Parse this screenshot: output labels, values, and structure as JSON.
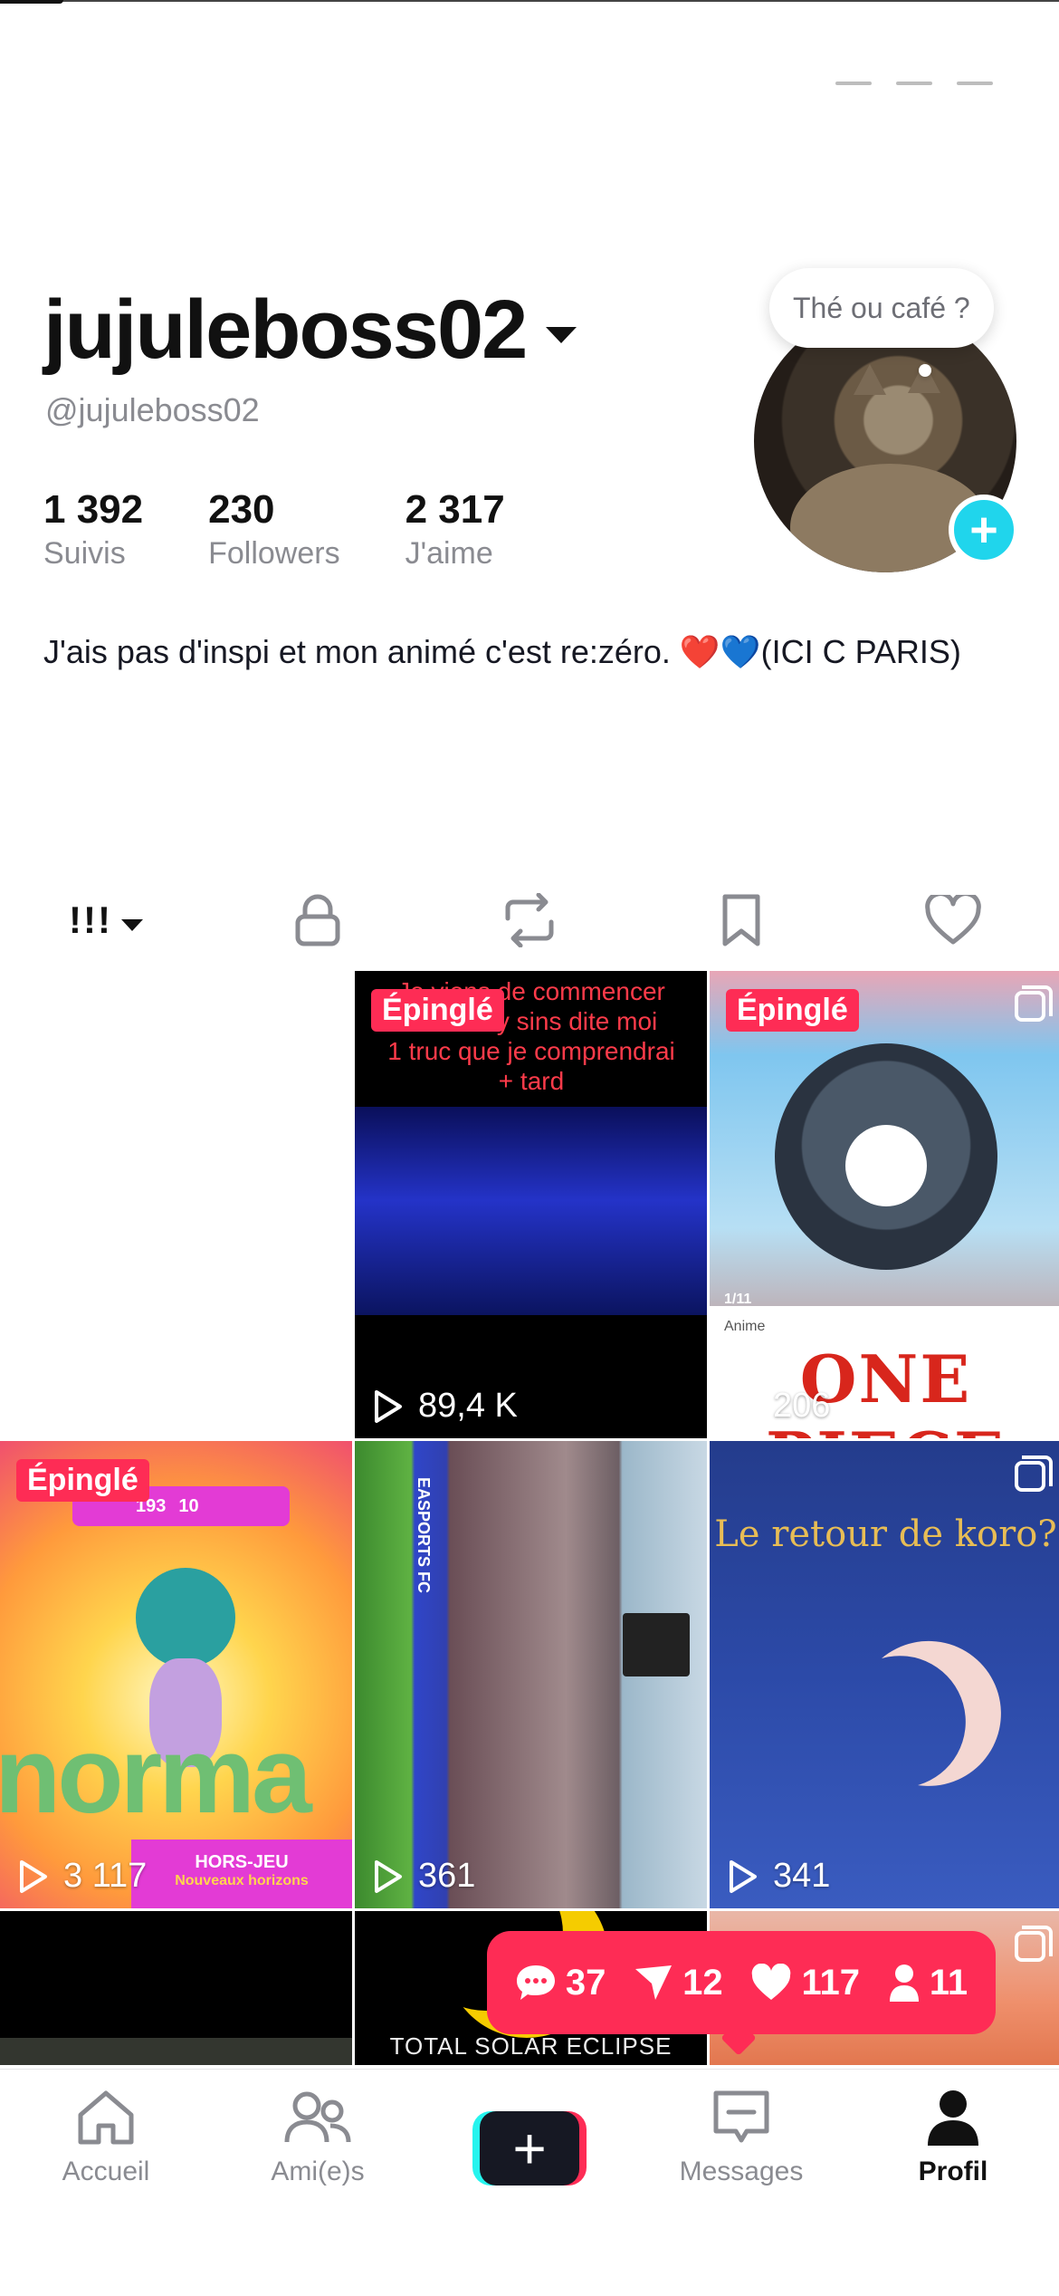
{
  "profile": {
    "display_name": "jujuleboss02",
    "handle": "@jujuleboss02",
    "bubble_text": "Thé ou café ?",
    "add_symbol": "+",
    "stats": [
      {
        "value": "1 392",
        "label": "Suivis"
      },
      {
        "value": "230",
        "label": "Followers"
      },
      {
        "value": "2 317",
        "label": "J'aime"
      }
    ],
    "bio": "J'ais pas d'inspi et mon animé c'est re:zéro. ❤️💙(ICI C PARIS)"
  },
  "tabs": {
    "grid_icon": "!!!",
    "items": [
      "videos-grid-icon",
      "lock-icon",
      "repost-icon",
      "bookmark-icon",
      "heart-icon"
    ]
  },
  "videos": [
    {
      "pinned_label": "",
      "views": ""
    },
    {
      "pinned_label": "Épinglé",
      "views": "89,4 K",
      "overlay_text": "Je viens de commencer\nmais Lilly sins dite moi\n1 truc que je comprendrai\n+ tard"
    },
    {
      "pinned_label": "Épinglé",
      "views": "206",
      "overlay_text": "ONE PIECE",
      "counter": "1/11",
      "category": "Anime"
    },
    {
      "pinned_label": "Épinglé",
      "views": "3 117",
      "overlay_text": "norma",
      "caption": "HORS-JEU",
      "subcaption": "Nouveaux horizons",
      "numbers": [
        "193",
        "10"
      ]
    },
    {
      "pinned_label": "",
      "views": "361",
      "overlay_text": "EASPORTS FC"
    },
    {
      "pinned_label": "",
      "views": "341",
      "overlay_text": "Le retour de koro?"
    },
    {
      "pinned_label": "",
      "views": ""
    },
    {
      "pinned_label": "",
      "views": "",
      "overlay_text": "TOTAL SOLAR ECLIPSE"
    },
    {
      "pinned_label": "",
      "views": ""
    }
  ],
  "notifications": {
    "comments": "37",
    "shares": "12",
    "likes": "117",
    "followers": "11"
  },
  "bottom_nav": [
    {
      "label": "Accueil",
      "icon": "home-icon"
    },
    {
      "label": "Ami(e)s",
      "icon": "friends-icon"
    },
    {
      "label": "+",
      "icon": "create-icon"
    },
    {
      "label": "Messages",
      "icon": "messages-icon"
    },
    {
      "label": "Profil",
      "icon": "profile-icon"
    }
  ],
  "colors": {
    "accent": "#fe2c55",
    "cyan": "#25f4ee",
    "text_muted": "#8a8b91"
  }
}
